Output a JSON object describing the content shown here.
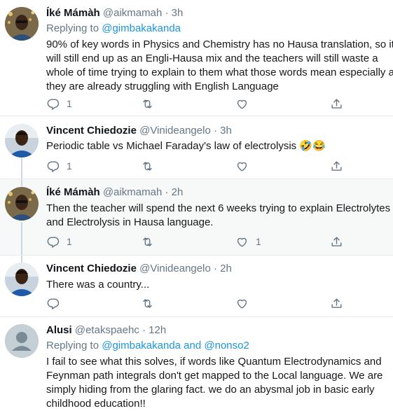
{
  "tweets": [
    {
      "name": "Íké Mámàh",
      "handle": "@aikmamah",
      "dot": "·",
      "time": "3h",
      "replying_label": "Replying to ",
      "replying_to": "@gimbakakanda",
      "lines": [
        "90% of key words in Physics and Chemistry has no Hausa translation, so it",
        "will still end up as an Engli-Hausa mix and the teachers will still waste a",
        "whole of time trying to explain to them what those words mean especially as",
        "they are already struggling with English Language"
      ],
      "reply_count": "1",
      "retweet_count": "",
      "like_count": ""
    },
    {
      "name": "Vincent Chiedozie",
      "handle": "@Vinideangelo",
      "dot": "·",
      "time": "3h",
      "lines": [
        "Periodic table vs Michael Faraday's law of electrolysis 🤣😂"
      ],
      "reply_count": "1",
      "retweet_count": "",
      "like_count": ""
    },
    {
      "name": "Íké Mámàh",
      "handle": "@aikmamah",
      "dot": "·",
      "time": "2h",
      "lines": [
        "Then the teacher will spend the next 6 weeks trying to explain Electrolytes",
        "and Electrolysis in Hausa language."
      ],
      "reply_count": "1",
      "retweet_count": "",
      "like_count": "1"
    },
    {
      "name": "Vincent Chiedozie",
      "handle": "@Vinideangelo",
      "dot": "·",
      "time": "2h",
      "lines": [
        "There was a country..."
      ],
      "reply_count": "",
      "retweet_count": "",
      "like_count": ""
    },
    {
      "name": "Alusi",
      "handle": "@etakspaehc",
      "dot": "·",
      "time": "12h",
      "replying_label": "Replying to ",
      "replying_to": "@gimbakakanda",
      "replying_and": " and ",
      "replying_to_2": "@nonso2",
      "lines": [
        "I fail to see what this solves, if words like Quantum Electrodynamics and",
        "Feynman path integrals don't get mapped to the Local language. We are",
        "simply hiding from the glaring fact. we do an abysmal job in basic early",
        "childhood education!!"
      ],
      "reply_count": "",
      "retweet_count": "",
      "like_count": ""
    }
  ],
  "icons": {
    "reply": "reply-icon",
    "retweet": "retweet-icon",
    "like": "like-icon",
    "share": "share-icon",
    "avatar_default": "default-avatar-icon"
  },
  "colors": {
    "link": "#1b95e0",
    "muted": "#657786",
    "separator": "#e6ecf0",
    "highlight_bg": "#f7f9f9"
  }
}
